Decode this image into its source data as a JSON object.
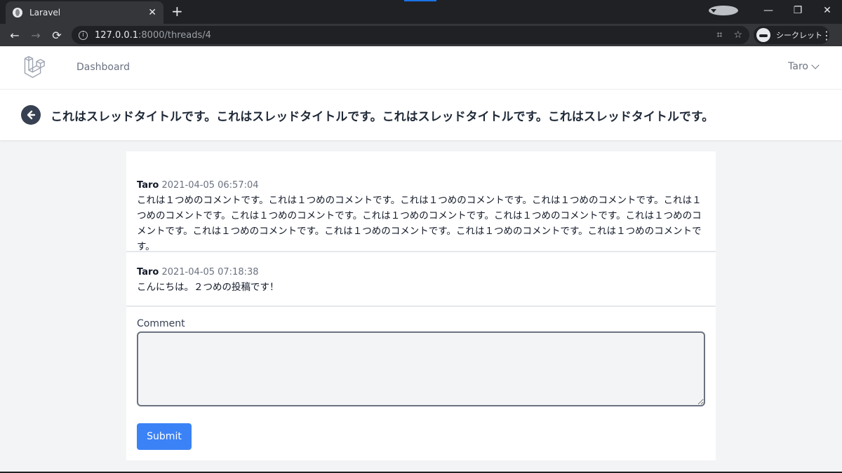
{
  "browser": {
    "tab_title": "Laravel",
    "tab_close": "✕",
    "new_tab": "+",
    "url_host": "127.0.0.1",
    "url_path": ":8000/threads/4",
    "incognito_label": "シークレット",
    "window": {
      "minimize": "—",
      "restore": "❐",
      "close": "✕"
    }
  },
  "app": {
    "nav": {
      "dashboard": "Dashboard",
      "user": "Taro"
    },
    "thread_title": "これはスレッドタイトルです。これはスレッドタイトルです。これはスレッドタイトルです。これはスレッドタイトルです。"
  },
  "comments": [
    {
      "author": "Taro",
      "time": "2021-04-05 06:57:04",
      "body": "これは１つめのコメントです。これは１つめのコメントです。これは１つめのコメントです。これは１つめのコメントです。これは１つめのコメントです。これは１つめのコメントです。これは１つめのコメントです。これは１つめのコメントです。これは１つめのコメントです。これは１つめのコメントです。これは１つめのコメントです。これは１つめのコメントです。これは１つめのコメントです。"
    },
    {
      "author": "Taro",
      "time": "2021-04-05 07:18:38",
      "body": "こんにちは。２つめの投稿です！"
    }
  ],
  "form": {
    "label": "Comment",
    "value": "",
    "submit_label": "Submit"
  },
  "colors": {
    "accent": "#3b82f6",
    "chrome_dark": "#202124"
  }
}
